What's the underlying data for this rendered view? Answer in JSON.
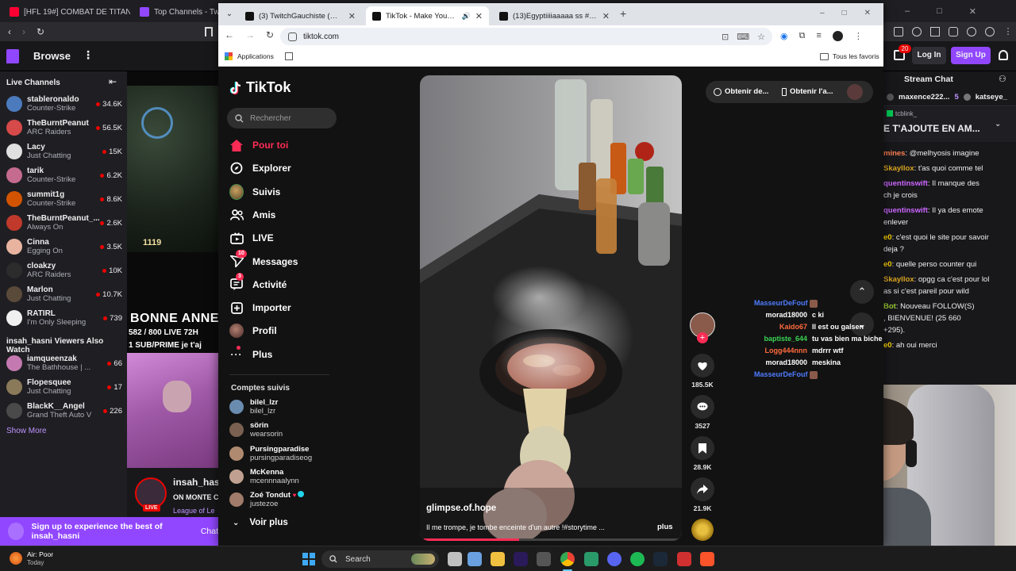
{
  "bg_browser": {
    "tabs": [
      {
        "label": "[HFL 19#] COMBAT DE TITANS IL SE",
        "color": "#ff0033"
      },
      {
        "label": "Top Channels - Twitch",
        "color": "#9147ff"
      }
    ]
  },
  "twitch": {
    "browse": "Browse",
    "login": "Log In",
    "signup": "Sign Up",
    "notif_count": "20",
    "live_channels_title": "Live Channels",
    "channels": [
      {
        "name": "stableronaldo",
        "game": "Counter-Strike",
        "viewers": "34.6K",
        "color": "#4b7bbd"
      },
      {
        "name": "TheBurntPeanut",
        "game": "ARC Raiders",
        "viewers": "56.5K",
        "color": "#d64a4a"
      },
      {
        "name": "Lacy",
        "game": "Just Chatting",
        "viewers": "15K",
        "color": "#e0e0e0"
      },
      {
        "name": "tarik",
        "game": "Counter-Strike",
        "viewers": "6.2K",
        "color": "#c46b8f"
      },
      {
        "name": "summit1g",
        "game": "Counter-Strike",
        "viewers": "8.6K",
        "color": "#d35400"
      },
      {
        "name": "TheBurntPeanut_...",
        "game": "Always On",
        "viewers": "2.6K",
        "color": "#c0392b"
      },
      {
        "name": "Cinna",
        "game": "Egging On",
        "viewers": "3.5K",
        "color": "#e8b4a0"
      },
      {
        "name": "cloakzy",
        "game": "ARC Raiders",
        "viewers": "10K",
        "color": "#2c2c2c"
      },
      {
        "name": "Marlon",
        "game": "Just Chatting",
        "viewers": "10.7K",
        "color": "#5a4a3a"
      },
      {
        "name": "RATIRL",
        "game": "I'm Only Sleeping",
        "viewers": "739",
        "color": "#f0f0f0"
      }
    ],
    "also_watch_title": "insah_hasni Viewers Also Watch",
    "also_watch": [
      {
        "name": "iamqueenzak",
        "game": "The Bathhouse | ...",
        "viewers": "66",
        "color": "#c47ab0"
      },
      {
        "name": "Flopesquee",
        "game": "Just Chatting",
        "viewers": "17",
        "color": "#8a7a5a"
      },
      {
        "name": "BlackK__Angel",
        "game": "Grand Theft Auto V",
        "viewers": "226",
        "color": "#4a4a4a"
      }
    ],
    "show_more": "Show More",
    "stream_overlay": {
      "timer": "1119",
      "banner": "BONNE ANNE",
      "sub_goal": "582 / 800  LIVE 72H",
      "sub_prime": "1 SUB/PRIME  je t'aj"
    },
    "streamer": {
      "name": "insah_hasni",
      "title": "ON MONTE C",
      "game": "League of Le",
      "live": "LIVE"
    },
    "signup_banner": "Sign up to experience the best of insah_hasni",
    "signup_banner_tail": "Chat",
    "chat_title": "Stream Chat",
    "chat_top_users": [
      {
        "name": "maxence222...",
        "count": "5"
      },
      {
        "name": "katseye_",
        "count": ""
      }
    ],
    "pinned": {
      "user": "tcblink_",
      "text": "E T'AJOUTE EN AM..."
    },
    "chat": [
      {
        "user": "mines",
        "color": "#ff7f50",
        "text": ": @melhyosis imagine"
      },
      {
        "user": "Skayllox",
        "color": "#daa520",
        "text": ": t'as quoi comme tel"
      },
      {
        "user": "quentinswift",
        "color": "#cc66ff",
        "text": ": Il manque des"
      },
      {
        "user": "",
        "color": "#efeff1",
        "text": "ch je crois"
      },
      {
        "user": "quentinswift",
        "color": "#cc66ff",
        "text": ": Il ya des emote"
      },
      {
        "user": "",
        "color": "#efeff1",
        "text": "enlever"
      },
      {
        "user": "e0",
        "color": "#ffd700",
        "text": ": c'est quoi le site pour savoir"
      },
      {
        "user": "",
        "color": "#efeff1",
        "text": "deja ?"
      },
      {
        "user": "e0",
        "color": "#ffd700",
        "text": ": quelle perso counter qui"
      },
      {
        "user": "Skayllox",
        "color": "#daa520",
        "text": ": opgg ca c'est pour lol"
      },
      {
        "user": "",
        "color": "#efeff1",
        "text": "as si c'est pareil pour wild"
      },
      {
        "user": "Bot",
        "color": "#9acd32",
        "text": ": Nouveau FOLLOW(S)"
      },
      {
        "user": "",
        "color": "#efeff1",
        "text": ", BIENVENUE! (25 660"
      },
      {
        "user": "",
        "color": "#efeff1",
        "text": "+295)."
      },
      {
        "user": "e0",
        "color": "#ffd700",
        "text": ": ah oui merci"
      }
    ]
  },
  "chrome": {
    "tabs": [
      {
        "label": "(3) TwitchGauchiste (@TwitchG...",
        "active": false
      },
      {
        "label": "TikTok - Make Your Day",
        "active": true
      },
      {
        "label": "(13)Egyptiiiiaaaaa ss #cleopatr...",
        "active": false
      }
    ],
    "url": "tiktok.com",
    "bookmarks_apps": "Applications",
    "bookmarks_all": "Tous les favoris"
  },
  "tiktok": {
    "logo": "TikTok",
    "search_placeholder": "Rechercher",
    "nav": [
      {
        "label": "Pour toi",
        "icon": "home-icon",
        "active": true,
        "badge": ""
      },
      {
        "label": "Explorer",
        "icon": "compass-icon",
        "active": false,
        "badge": ""
      },
      {
        "label": "Suivis",
        "icon": "following-avatar-icon",
        "active": false,
        "badge": ""
      },
      {
        "label": "Amis",
        "icon": "friends-icon",
        "active": false,
        "badge": ""
      },
      {
        "label": "LIVE",
        "icon": "live-icon",
        "active": false,
        "badge": ""
      },
      {
        "label": "Messages",
        "icon": "message-icon",
        "active": false,
        "badge": "10"
      },
      {
        "label": "Activité",
        "icon": "activity-icon",
        "active": false,
        "badge": "3"
      },
      {
        "label": "Importer",
        "icon": "upload-icon",
        "active": false,
        "badge": ""
      },
      {
        "label": "Profil",
        "icon": "profile-avatar-icon",
        "active": false,
        "badge": ""
      },
      {
        "label": "Plus",
        "icon": "more-icon",
        "active": false,
        "badge": ""
      }
    ],
    "followed_title": "Comptes suivis",
    "followed": [
      {
        "display": "bilel_lzr",
        "handle": "bilel_lzr",
        "color": "#6a8caf"
      },
      {
        "display": "sörin",
        "handle": "wearsorin",
        "color": "#7a6050"
      },
      {
        "display": "Pursingparadise",
        "handle": "pursingparadiseog",
        "color": "#b08a70"
      },
      {
        "display": "McKenna",
        "handle": "mcennnaalynn",
        "color": "#c0a090"
      },
      {
        "display": "Zoé Tondut",
        "handle": "justezoe",
        "color": "#a07a6a"
      }
    ],
    "see_more": "Voir plus",
    "header_buttons": [
      "Obtenir de...",
      "Obtenir l'a..."
    ],
    "video": {
      "author": "glimpse.of.hope",
      "caption": "Il me trompe, je tombe enceinte d'un autre !#storytime ...",
      "more": "plus",
      "progress_pct": 38
    },
    "actions": {
      "likes": "185.5K",
      "comments": "3527",
      "saves": "28.9K",
      "shares": "21.9K"
    }
  },
  "chat_overlay": [
    {
      "user": "MasseurDeFouf",
      "user_color": "#4f7cff",
      "text": ""
    },
    {
      "user": "morad18000",
      "user_color": "#ffffff",
      "text": "c ki"
    },
    {
      "user": "Kaido67",
      "user_color": "#ff6a3d",
      "text": "Il est ou galsen"
    },
    {
      "user": "baptiste_644",
      "user_color": "#39d353",
      "text": "tu vas bien ma biche"
    },
    {
      "user": "Logg444nnn",
      "user_color": "#ff6a3d",
      "text": "mdrrr wtf"
    },
    {
      "user": "morad18000",
      "user_color": "#ffffff",
      "text": "meskina"
    },
    {
      "user": "MasseurDeFouf",
      "user_color": "#4f7cff",
      "text": ""
    }
  ],
  "taskbar": {
    "weather_title": "Air: Poor",
    "weather_sub": "Today",
    "search": "Search"
  }
}
